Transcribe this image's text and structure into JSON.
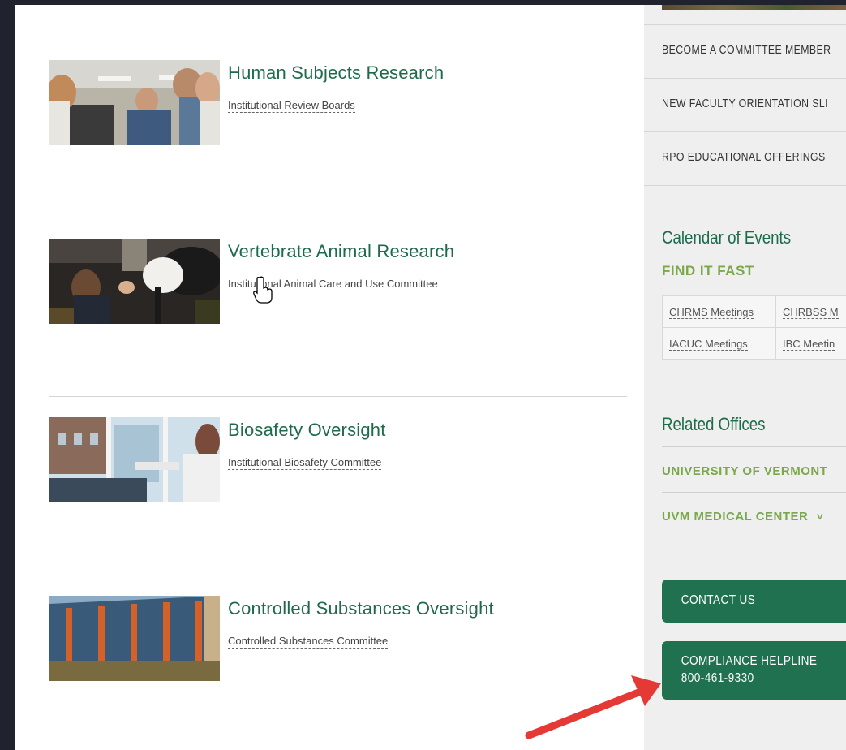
{
  "cards": [
    {
      "title": "Human Subjects Research",
      "link": "Institutional Review Boards"
    },
    {
      "title": "Vertebrate Animal Research",
      "link": "Institutional Animal Care and Use Committee"
    },
    {
      "title": "Biosafety Oversight",
      "link": "Institutional Biosafety Committee"
    },
    {
      "title": "Controlled Substances Oversight",
      "link": "Controlled Substances Committee"
    }
  ],
  "sidebar": {
    "items": [
      {
        "label": "BECOME A COMMITTEE MEMBER"
      },
      {
        "label": "NEW FACULTY ORIENTATION SLI"
      },
      {
        "label": "RPO EDUCATIONAL OFFERINGS"
      }
    ],
    "calendar_title": "Calendar of Events",
    "find_it_fast": "FIND IT FAST",
    "quick_links": [
      [
        "CHRMS Meetings",
        "CHRBSS M"
      ],
      [
        "IACUC Meetings",
        "IBC Meetin"
      ]
    ],
    "related_title": "Related Offices",
    "related": [
      {
        "label": "UNIVERSITY OF VERMONT"
      },
      {
        "label": "UVM MEDICAL CENTER",
        "chevron": "˅"
      }
    ],
    "contact_label": "CONTACT US",
    "helpline_label": "COMPLIANCE HELPLINE",
    "helpline_number": "800-461-9330"
  },
  "colors": {
    "accent": "#1e6b4c",
    "link_green": "#7aa84a",
    "button": "#1f7150",
    "annotation_arrow": "#e53935"
  }
}
